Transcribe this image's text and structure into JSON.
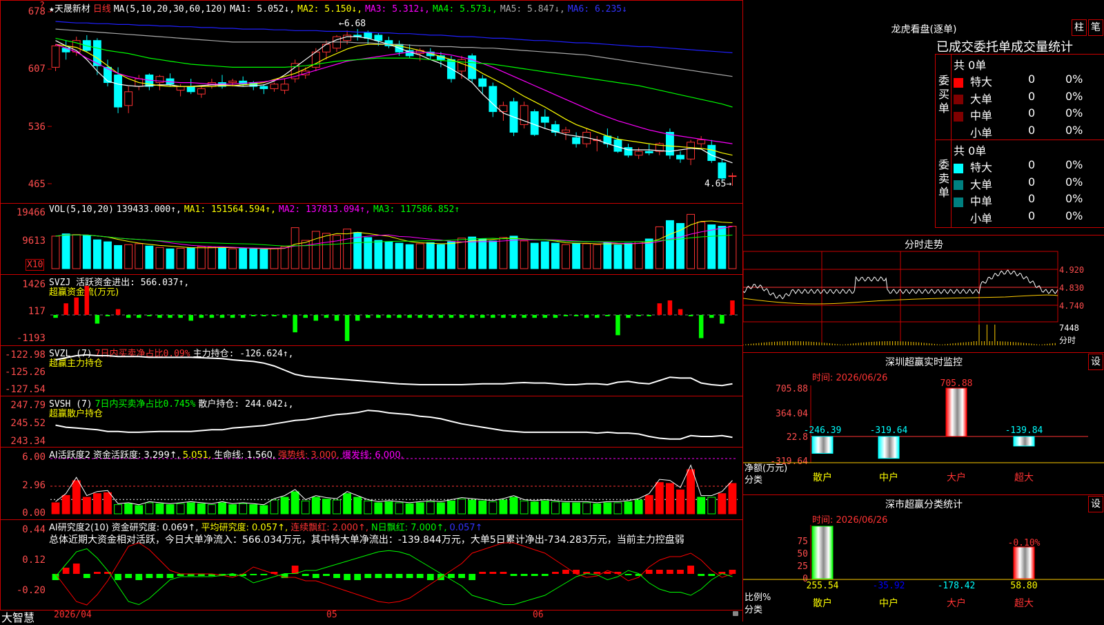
{
  "header": {
    "star": "★",
    "stock_name": "天晟新材",
    "period": "日线",
    "ma_label": "MA(5,10,20,30,60,120)",
    "ma_items": [
      {
        "text": "MA1: 5.052↓,",
        "color": "#ffffff"
      },
      {
        "text": "MA2: 5.150↓,",
        "color": "#ffff00"
      },
      {
        "text": "MA3: 5.312↓,",
        "color": "#ff00ff"
      },
      {
        "text": "MA4: 5.573↓,",
        "color": "#00ff00"
      },
      {
        "text": "MA5: 5.847↓,",
        "color": "#aaaaaa"
      },
      {
        "text": "MA6: 6.235↓",
        "color": "#3333ff"
      }
    ],
    "mark": "?"
  },
  "price_axis": [
    "678",
    "607",
    "536",
    "465"
  ],
  "high_mark": "6.68",
  "low_mark": "4.65",
  "vol": {
    "axis": [
      "19466",
      "9613"
    ],
    "unit": "X10",
    "items": [
      {
        "text": "VOL(5,10,20)",
        "color": "#ffffff"
      },
      {
        "text": "139433.000↑,",
        "color": "#ffffff"
      },
      {
        "text": "MA1: 151564.594↑,",
        "color": "#ffff00"
      },
      {
        "text": "MA2: 137813.094↑,",
        "color": "#ff00ff"
      },
      {
        "text": "MA3: 117586.852↑",
        "color": "#00ff00"
      }
    ]
  },
  "svzj": {
    "axis": [
      "1426",
      "117",
      "-1193"
    ],
    "line1": "SVZJ  活跃资金进出: 566.037↑,",
    "line2": "超赢资金流(万元)"
  },
  "svzl": {
    "axis": [
      "-122.98",
      "-125.26",
      "-127.54"
    ],
    "items": [
      {
        "text": "SVZL (7)",
        "color": "#ffffff"
      },
      {
        "text": "7日内买卖净占比0.09%",
        "color": "#ff3333"
      },
      {
        "text": "主力持仓: -126.624↑,",
        "color": "#ffffff"
      }
    ],
    "line2": "超赢主力持仓"
  },
  "svsh": {
    "axis": [
      "247.79",
      "245.52",
      "243.34"
    ],
    "items": [
      {
        "text": "SVSH (7)",
        "color": "#ffffff"
      },
      {
        "text": "7日内买卖净占比0.745%",
        "color": "#00ff00"
      },
      {
        "text": "散户持仓: 244.042↓,",
        "color": "#ffffff"
      }
    ],
    "line2": "超赢散户持仓"
  },
  "ai1": {
    "axis": [
      "6.00",
      "2.96",
      "0.00"
    ],
    "items": [
      {
        "text": "AI活跃度2",
        "color": "#ffffff"
      },
      {
        "text": "资金活跃度: 3.299↑,",
        "color": "#ffffff"
      },
      {
        "text": "5.051,",
        "color": "#ffff00"
      },
      {
        "text": "生命线: 1.560,",
        "color": "#ffffff"
      },
      {
        "text": "强势线: 3.000,",
        "color": "#ff3333"
      },
      {
        "text": "爆发线: 6.000,",
        "color": "#ff00ff"
      }
    ]
  },
  "ai2": {
    "axis": [
      "0.44",
      "0.12",
      "-0.20"
    ],
    "items": [
      {
        "text": "AI研究度2(10)",
        "color": "#ffffff"
      },
      {
        "text": "资金研究度: 0.069↑,",
        "color": "#ffffff"
      },
      {
        "text": "平均研究度: 0.057↑,",
        "color": "#ffff00"
      },
      {
        "text": "连续飘红: 2.000↑,",
        "color": "#ff3333"
      },
      {
        "text": "N日飘红: 7.000↑,",
        "color": "#00ff00"
      },
      {
        "text": "0.057↑",
        "color": "#3333ff"
      }
    ],
    "summary": "总体近期大资金相对活跃，今日大单净流入：566.034万元，其中特大单净流出：-139.844万元，大单5日累计净出-734.283万元，当前主力控盘弱"
  },
  "xaxis": {
    "brand": "大智慧",
    "dates": [
      "2026/04",
      "05",
      "06"
    ]
  },
  "right": {
    "lhb_title": "龙虎看盘(逐单)",
    "btn1": "柱",
    "btn2": "笔",
    "tabs": "已成交委托单成交量统计",
    "buy_side": "委买单",
    "sell_side": "委卖单",
    "total": "共 0单",
    "rows": [
      {
        "label": "特大",
        "count": "0",
        "pct": "0%"
      },
      {
        "label": "大单",
        "count": "0",
        "pct": "0%"
      },
      {
        "label": "中单",
        "count": "0",
        "pct": "0%"
      },
      {
        "label": "小单",
        "count": "0",
        "pct": "0%"
      }
    ],
    "buy_colors": [
      "#ff0000",
      "#800000",
      "#800000",
      ""
    ],
    "sell_colors": [
      "#00ffff",
      "#008080",
      "#008080",
      ""
    ],
    "intraday_title": "分时走势",
    "intraday_axis": [
      "4.920",
      "4.830",
      "4.740"
    ],
    "intraday_vol": "7448",
    "intraday_unit": "分时",
    "sz_title": "深圳超赢实时监控",
    "sz_btn": "设",
    "sz_time": "时间: 2026/06/26",
    "sz_axis": [
      "705.88",
      "364.04",
      "22.8",
      "-319.64"
    ],
    "sz_values": [
      "-246.39",
      "-319.64",
      "705.88",
      "-139.84"
    ],
    "sz_label_y": "净额(万元)",
    "sz_label_cat": "分类",
    "cats": [
      "散户",
      "中户",
      "大户",
      "超大"
    ],
    "cls_title": "深市超赢分类统计",
    "cls_btn": "设",
    "cls_time": "时间: 2026/06/26",
    "cls_axis": [
      "75",
      "50",
      "25",
      "0"
    ],
    "cls_top": "-0.10%",
    "cls_values": [
      "255.54",
      "-35.92",
      "-178.42",
      "58.80"
    ],
    "cls_label_y": "比例%",
    "cls_label_cat": "分类"
  },
  "chart_data": {
    "type": "candlestick",
    "title": "天晟新材 日线",
    "ylim": [
      4.65,
      6.8
    ],
    "ohlc": [
      [
        6.2,
        6.5,
        6.15,
        6.48
      ],
      [
        6.45,
        6.55,
        6.3,
        6.4
      ],
      [
        6.4,
        6.6,
        6.35,
        6.55
      ],
      [
        6.55,
        6.62,
        6.4,
        6.42
      ],
      [
        6.55,
        6.58,
        6.1,
        6.22
      ],
      [
        6.2,
        6.3,
        5.95,
        6.0
      ],
      [
        6.1,
        6.2,
        5.6,
        5.68
      ],
      [
        5.7,
        5.95,
        5.6,
        5.88
      ],
      [
        5.95,
        6.1,
        5.9,
        6.05
      ],
      [
        6.1,
        6.12,
        5.9,
        5.95
      ],
      [
        6.0,
        6.1,
        5.9,
        6.08
      ],
      [
        6.05,
        6.12,
        5.95,
        5.98
      ],
      [
        5.9,
        5.98,
        5.82,
        5.95
      ],
      [
        5.95,
        6.05,
        5.85,
        5.88
      ],
      [
        5.85,
        5.95,
        5.8,
        5.92
      ],
      [
        5.95,
        6.05,
        5.92,
        6.0
      ],
      [
        6.0,
        6.1,
        5.92,
        5.95
      ],
      [
        6.0,
        6.05,
        5.95,
        6.02
      ],
      [
        6.02,
        6.08,
        5.95,
        5.98
      ],
      [
        6.0,
        6.02,
        5.9,
        5.95
      ],
      [
        5.95,
        5.98,
        5.85,
        5.92
      ],
      [
        5.92,
        6.0,
        5.88,
        5.98
      ],
      [
        5.9,
        6.05,
        5.85,
        5.98
      ],
      [
        6.05,
        6.3,
        6.0,
        6.25
      ],
      [
        6.1,
        6.2,
        6.05,
        6.15
      ],
      [
        6.2,
        6.45,
        6.15,
        6.4
      ],
      [
        6.4,
        6.55,
        6.3,
        6.5
      ],
      [
        6.45,
        6.62,
        6.4,
        6.6
      ],
      [
        6.55,
        6.68,
        6.5,
        6.62
      ],
      [
        6.62,
        6.7,
        6.55,
        6.6
      ],
      [
        6.65,
        6.68,
        6.5,
        6.58
      ],
      [
        6.62,
        6.65,
        6.48,
        6.55
      ],
      [
        6.55,
        6.6,
        6.45,
        6.48
      ],
      [
        6.5,
        6.55,
        6.35,
        6.4
      ],
      [
        6.42,
        6.5,
        6.32,
        6.35
      ],
      [
        6.38,
        6.45,
        6.28,
        6.42
      ],
      [
        6.4,
        6.45,
        6.3,
        6.35
      ],
      [
        6.35,
        6.4,
        6.2,
        6.3
      ],
      [
        6.3,
        6.35,
        6.0,
        6.05
      ],
      [
        6.15,
        6.35,
        6.05,
        6.3
      ],
      [
        6.35,
        6.38,
        6.0,
        6.05
      ],
      [
        6.05,
        6.1,
        5.85,
        5.95
      ],
      [
        5.95,
        6.0,
        5.55,
        5.62
      ],
      [
        5.62,
        5.75,
        5.5,
        5.7
      ],
      [
        5.75,
        5.8,
        5.3,
        5.35
      ],
      [
        5.45,
        5.75,
        5.4,
        5.7
      ],
      [
        5.62,
        5.65,
        5.3,
        5.32
      ],
      [
        5.55,
        5.65,
        5.4,
        5.48
      ],
      [
        5.45,
        5.5,
        5.3,
        5.35
      ],
      [
        5.35,
        5.42,
        5.25,
        5.38
      ],
      [
        5.28,
        5.35,
        5.15,
        5.2
      ],
      [
        5.2,
        5.4,
        5.15,
        5.35
      ],
      [
        5.25,
        5.3,
        5.1,
        5.25
      ],
      [
        5.3,
        5.4,
        5.15,
        5.2
      ],
      [
        5.25,
        5.3,
        5.08,
        5.1
      ],
      [
        5.15,
        5.2,
        5.02,
        5.05
      ],
      [
        5.05,
        5.15,
        5.0,
        5.1
      ],
      [
        5.1,
        5.2,
        5.05,
        5.08
      ],
      [
        5.1,
        5.22,
        5.05,
        5.2
      ],
      [
        5.35,
        5.4,
        5.0,
        5.05
      ],
      [
        5.05,
        5.1,
        4.95,
        5.0
      ],
      [
        5.0,
        5.25,
        4.92,
        5.22
      ],
      [
        5.2,
        5.3,
        5.15,
        5.25
      ],
      [
        5.18,
        5.25,
        4.95,
        4.98
      ],
      [
        4.95,
        5.0,
        4.72,
        4.75
      ],
      [
        4.78,
        4.82,
        4.65,
        4.78
      ]
    ],
    "ma": [
      {
        "name": "MA1",
        "color": "#ffffff",
        "values": [
          6.55,
          6.48,
          6.42,
          6.3,
          6.15,
          6.02,
          5.98,
          5.96,
          5.95,
          5.96,
          5.97,
          5.97,
          5.95,
          5.95,
          5.96,
          5.97,
          5.97,
          5.96,
          5.95,
          5.96,
          5.97,
          6.02,
          6.1,
          6.2,
          6.3,
          6.4,
          6.5,
          6.56,
          6.6,
          6.6,
          6.58,
          6.54,
          6.5,
          6.45,
          6.4,
          6.36,
          6.3,
          6.25,
          6.18,
          6.1,
          6.0,
          5.85,
          5.72,
          5.6,
          5.55,
          5.5,
          5.45,
          5.4,
          5.36,
          5.32,
          5.3,
          5.28,
          5.25,
          5.2,
          5.16,
          5.12,
          5.12,
          5.12,
          5.11,
          5.1,
          5.12,
          5.14,
          5.13,
          5.05,
          5.0,
          4.95
        ]
      },
      {
        "name": "MA2",
        "color": "#ffff00",
        "values": [
          6.5,
          6.48,
          6.46,
          6.4,
          6.32,
          6.22,
          6.12,
          6.05,
          6.0,
          5.98,
          5.96,
          5.95,
          5.95,
          5.95,
          5.95,
          5.95,
          5.96,
          5.96,
          5.97,
          5.98,
          6.0,
          6.04,
          6.08,
          6.12,
          6.18,
          6.25,
          6.32,
          6.38,
          6.44,
          6.48,
          6.5,
          6.5,
          6.5,
          6.48,
          6.45,
          6.42,
          6.38,
          6.34,
          6.3,
          6.25,
          6.2,
          6.12,
          6.05,
          5.98,
          5.9,
          5.82,
          5.75,
          5.68,
          5.6,
          5.52,
          5.45,
          5.4,
          5.35,
          5.3,
          5.26,
          5.24,
          5.22,
          5.2,
          5.18,
          5.17,
          5.16,
          5.15,
          5.14,
          5.12,
          5.08,
          5.05
        ]
      },
      {
        "name": "MA3",
        "color": "#ff00ff",
        "values": [
          6.5,
          6.45,
          6.4,
          6.32,
          6.25,
          6.18,
          6.12,
          6.08,
          6.05,
          6.03,
          6.02,
          6.01,
          6.0,
          6.0,
          5.99,
          5.98,
          5.98,
          5.98,
          5.99,
          6.0,
          6.01,
          6.03,
          6.05,
          6.08,
          6.12,
          6.16,
          6.2,
          6.24,
          6.28,
          6.3,
          6.32,
          6.34,
          6.36,
          6.38,
          6.4,
          6.4,
          6.39,
          6.38,
          6.36,
          6.33,
          6.3,
          6.25,
          6.2,
          6.14,
          6.08,
          6.02,
          5.96,
          5.9,
          5.84,
          5.78,
          5.72,
          5.66,
          5.6,
          5.55,
          5.5,
          5.46,
          5.42,
          5.38,
          5.35,
          5.32,
          5.3,
          5.28,
          5.26,
          5.24,
          5.22,
          5.2
        ]
      },
      {
        "name": "MA4",
        "color": "#00ff00",
        "values": [
          6.58,
          6.55,
          6.52,
          6.48,
          6.45,
          6.42,
          6.4,
          6.38,
          6.35,
          6.32,
          6.3,
          6.28,
          6.26,
          6.24,
          6.23,
          6.22,
          6.21,
          6.2,
          6.2,
          6.2,
          6.2,
          6.2,
          6.2,
          6.21,
          6.22,
          6.24,
          6.26,
          6.28,
          6.29,
          6.3,
          6.31,
          6.32,
          6.32,
          6.32,
          6.32,
          6.31,
          6.3,
          6.29,
          6.28,
          6.27,
          6.26,
          6.25,
          6.24,
          6.22,
          6.2,
          6.18,
          6.16,
          6.14,
          6.12,
          6.1,
          6.08,
          6.06,
          6.04,
          6.02,
          6.0,
          5.98,
          5.96,
          5.93,
          5.9,
          5.87,
          5.84,
          5.81,
          5.78,
          5.75,
          5.72,
          5.68
        ]
      },
      {
        "name": "MA5",
        "color": "#aaaaaa",
        "values": [
          6.7,
          6.69,
          6.68,
          6.67,
          6.66,
          6.65,
          6.64,
          6.63,
          6.62,
          6.61,
          6.6,
          6.59,
          6.58,
          6.57,
          6.56,
          6.55,
          6.54,
          6.53,
          6.53,
          6.53,
          6.53,
          6.53,
          6.53,
          6.53,
          6.53,
          6.53,
          6.53,
          6.53,
          6.53,
          6.52,
          6.52,
          6.51,
          6.5,
          6.5,
          6.49,
          6.48,
          6.48,
          6.47,
          6.47,
          6.46,
          6.46,
          6.45,
          6.45,
          6.44,
          6.43,
          6.42,
          6.41,
          6.4,
          6.39,
          6.38,
          6.37,
          6.36,
          6.34,
          6.32,
          6.3,
          6.28,
          6.26,
          6.24,
          6.22,
          6.2,
          6.18,
          6.16,
          6.14,
          6.12,
          6.1,
          6.08
        ]
      },
      {
        "name": "MA6",
        "color": "#2020ff",
        "values": [
          6.8,
          6.79,
          6.78,
          6.78,
          6.77,
          6.77,
          6.76,
          6.76,
          6.75,
          6.75,
          6.74,
          6.74,
          6.73,
          6.73,
          6.72,
          6.72,
          6.71,
          6.71,
          6.7,
          6.7,
          6.7,
          6.69,
          6.69,
          6.68,
          6.68,
          6.68,
          6.67,
          6.67,
          6.67,
          6.66,
          6.66,
          6.65,
          6.65,
          6.64,
          6.64,
          6.63,
          6.62,
          6.62,
          6.61,
          6.6,
          6.6,
          6.59,
          6.58,
          6.58,
          6.57,
          6.56,
          6.55,
          6.55,
          6.54,
          6.53,
          6.52,
          6.52,
          6.51,
          6.5,
          6.49,
          6.48,
          6.47,
          6.47,
          6.46,
          6.45,
          6.44,
          6.43,
          6.42,
          6.41,
          6.4,
          6.39
        ]
      }
    ],
    "volume": [
      11500,
      12300,
      12100,
      11800,
      10200,
      9500,
      8200,
      8500,
      8800,
      8000,
      7500,
      7000,
      7200,
      7400,
      7800,
      7600,
      7300,
      7000,
      7100,
      7000,
      6800,
      7200,
      7800,
      14500,
      10000,
      13200,
      12500,
      11800,
      14000,
      12800,
      11000,
      10000,
      9500,
      9000,
      8500,
      8800,
      9200,
      8500,
      9500,
      10800,
      11200,
      10500,
      9800,
      11000,
      11500,
      9800,
      9000,
      9500,
      9000,
      8500,
      9000,
      8800,
      8500,
      9200,
      8400,
      9000,
      9500,
      10500,
      14800,
      17000,
      16000,
      19200,
      16500,
      15500,
      15000,
      15000
    ]
  }
}
